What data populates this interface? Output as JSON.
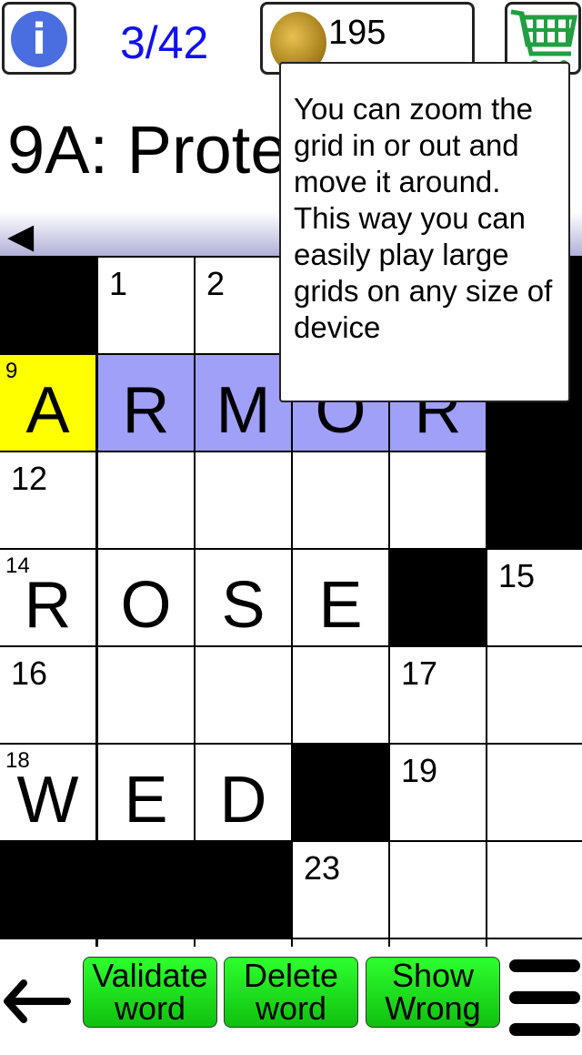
{
  "header": {
    "progress": "3/42",
    "coins": "195",
    "info_icon": "info-icon",
    "cart_icon": "shopping-cart-icon"
  },
  "clue": {
    "text": "9A: Prote"
  },
  "nav": {
    "prev_icon": "triangle-left-icon"
  },
  "tooltip": {
    "text": "You can zoom the grid in or out and move it around. This way you can easily play large grids on any size of device"
  },
  "grid": {
    "rows": [
      [
        {
          "t": "b"
        },
        {
          "n": "1"
        },
        {
          "n": "2"
        },
        {},
        {},
        {
          "t": "b"
        }
      ],
      [
        {
          "t": "cur",
          "n": "9",
          "l": "A"
        },
        {
          "t": "sel",
          "l": "R"
        },
        {
          "t": "sel",
          "l": "M"
        },
        {
          "t": "sel",
          "l": "O"
        },
        {
          "t": "sel",
          "l": "R"
        },
        {
          "t": "b"
        }
      ],
      [
        {
          "n": "12"
        },
        {},
        {},
        {},
        {},
        {
          "t": "b"
        }
      ],
      [
        {
          "n": "14",
          "l": "R"
        },
        {
          "l": "O"
        },
        {
          "l": "S"
        },
        {
          "l": "E"
        },
        {
          "t": "b"
        },
        {
          "n": "15"
        }
      ],
      [
        {
          "n": "16"
        },
        {},
        {},
        {},
        {
          "n": "17"
        },
        {}
      ],
      [
        {
          "n": "18",
          "l": "W"
        },
        {
          "l": "E"
        },
        {
          "l": "D"
        },
        {
          "t": "b"
        },
        {
          "n": "19"
        },
        {}
      ],
      [
        {
          "t": "b"
        },
        {
          "t": "b"
        },
        {
          "t": "b"
        },
        {
          "n": "23"
        },
        {},
        {}
      ],
      [
        {},
        {},
        {},
        {},
        {},
        {}
      ]
    ]
  },
  "bottom": {
    "validate": "Validate word",
    "delete": "Delete word",
    "show_wrong": "Show Wrong",
    "back_icon": "arrow-left-icon",
    "menu_icon": "hamburger-menu-icon"
  },
  "colors": {
    "current": "#ffff00",
    "selected": "#a0a0f8",
    "button": "#20e020",
    "progress": "#1010f0"
  }
}
